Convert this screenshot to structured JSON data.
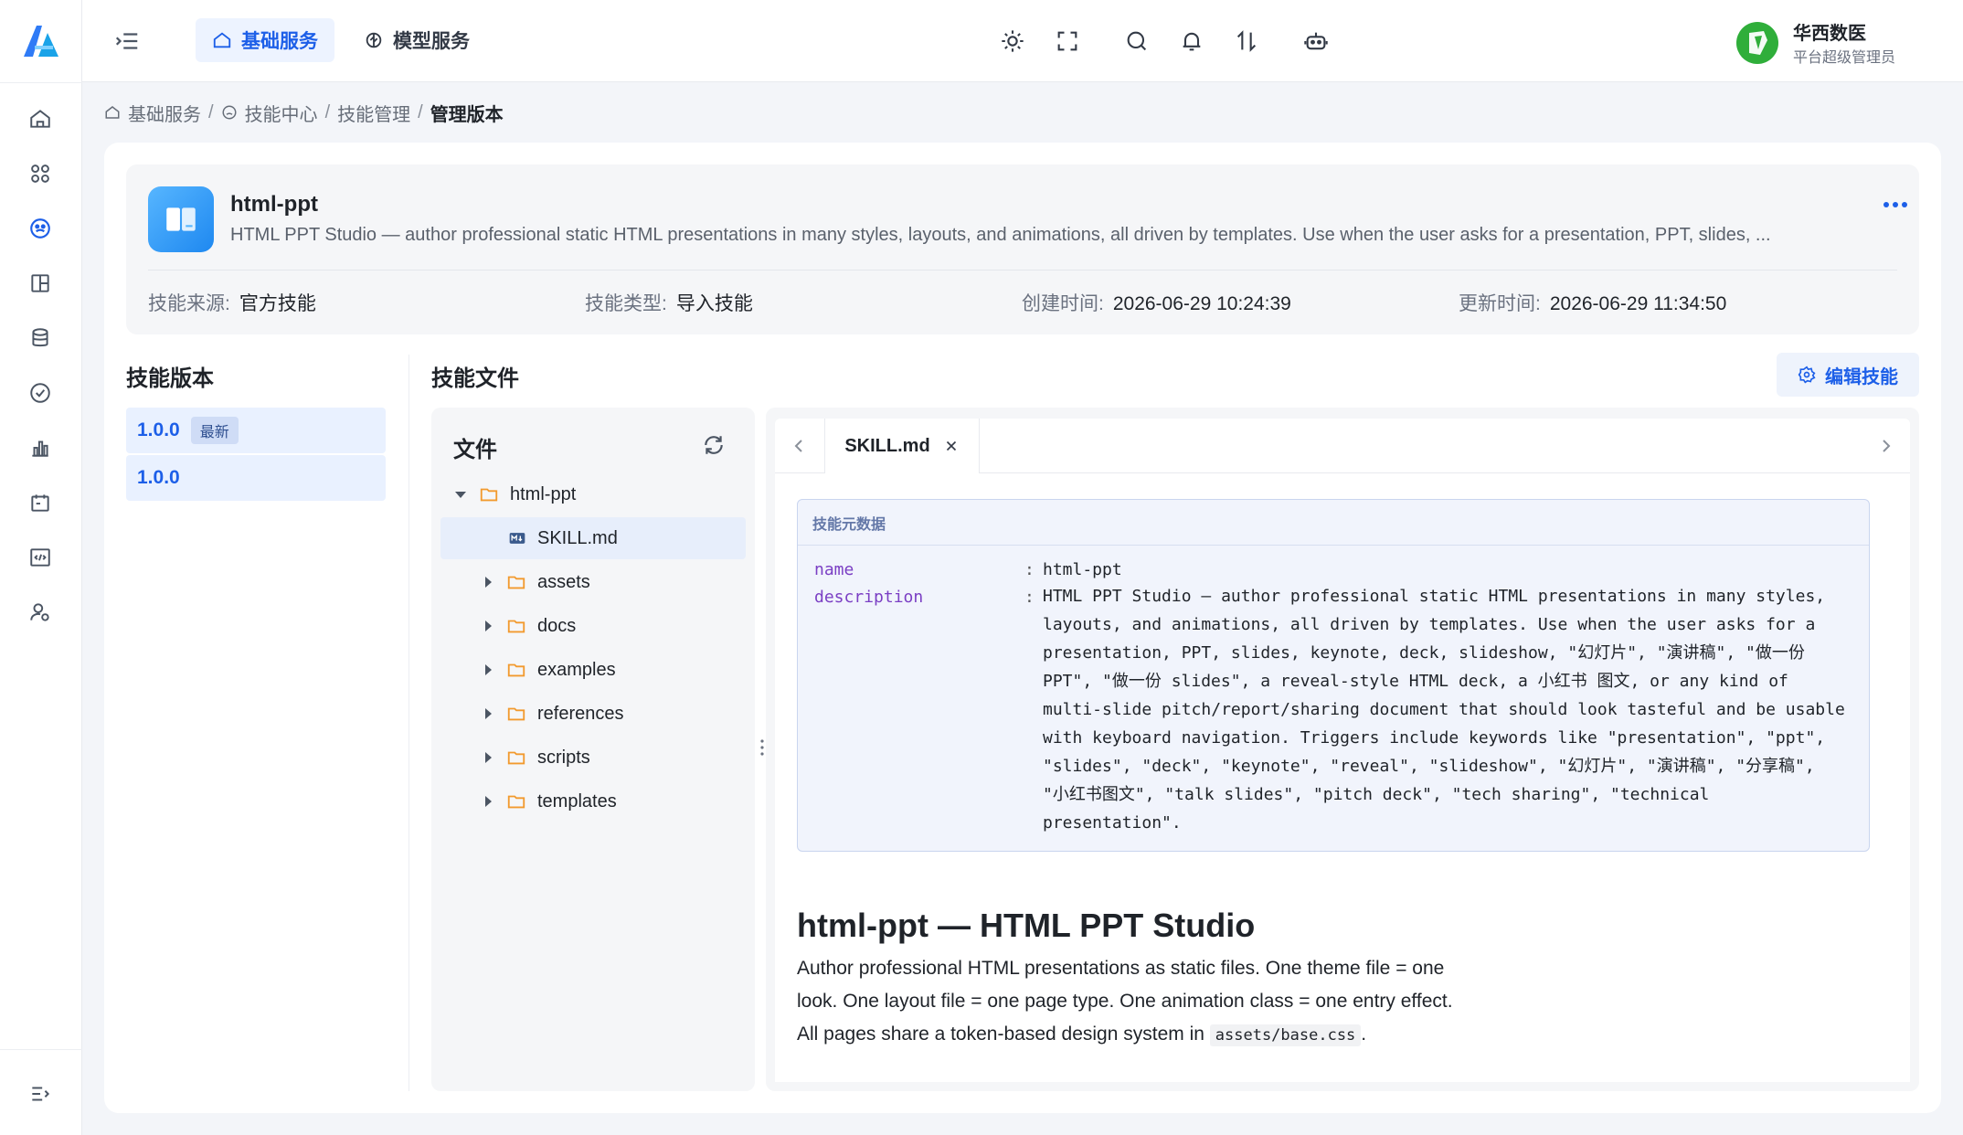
{
  "topbar": {
    "tabs": [
      {
        "label": "基础服务",
        "active": true
      },
      {
        "label": "模型服务",
        "active": false
      }
    ],
    "user": {
      "name": "华西数医",
      "role": "平台超级管理员"
    }
  },
  "breadcrumb": {
    "items": [
      "基础服务",
      "技能中心",
      "技能管理"
    ],
    "current": "管理版本",
    "separator": "/"
  },
  "skill": {
    "name": "html-ppt",
    "description": "HTML PPT Studio — author professional static HTML presentations in many styles, layouts, and animations, all driven by templates. Use when the user asks for a presentation, PPT, slides, ...",
    "meta": [
      {
        "key": "技能来源:",
        "value": "官方技能"
      },
      {
        "key": "技能类型:",
        "value": "导入技能"
      },
      {
        "key": "创建时间:",
        "value": "2026-06-29 10:24:39"
      },
      {
        "key": "更新时间:",
        "value": "2026-06-29 11:34:50"
      }
    ]
  },
  "versions": {
    "title": "技能版本",
    "items": [
      {
        "label": "1.0.0",
        "badge": "最新"
      },
      {
        "label": "1.0.0",
        "badge": ""
      }
    ]
  },
  "files": {
    "title": "技能文件",
    "edit_label": "编辑技能",
    "tree_title": "文件",
    "root": "html-ppt",
    "selected_file": "SKILL.md",
    "folders": [
      "assets",
      "docs",
      "examples",
      "references",
      "scripts",
      "templates"
    ]
  },
  "editor": {
    "tab": "SKILL.md",
    "meta_header": "技能元数据",
    "name_key": "name",
    "name_value": "html-ppt",
    "desc_key": "description",
    "desc_lines": [
      "HTML PPT Studio — author professional static HTML presentations in many styles,",
      "layouts, and animations, all driven by templates. Use when the user asks for a",
      "presentation, PPT, slides, keynote, deck, slideshow, \"幻灯片\", \"演讲稿\", \"做一份",
      "PPT\", \"做一份 slides\", a reveal-style HTML deck, a 小红书 图文, or any kind of",
      "multi-slide pitch/report/sharing document that should look tasteful and be usable",
      "with keyboard navigation. Triggers include keywords like \"presentation\", \"ppt\",",
      "\"slides\", \"deck\", \"keynote\", \"reveal\", \"slideshow\", \"幻灯片\", \"演讲稿\", \"分享稿\",",
      "\"小红书图文\", \"talk slides\", \"pitch deck\", \"tech sharing\", \"technical",
      "presentation\"."
    ],
    "heading": "html-ppt — HTML PPT Studio",
    "para_lines": [
      "Author professional HTML presentations as static files. One theme file = one",
      "look. One layout file = one page type. One animation class = one entry effect.",
      "All pages share a token-based design system in "
    ],
    "code": "assets/base.css",
    "para_end": "."
  },
  "colors": {
    "accent": "#1d5fe8",
    "folder": "#f29a2e"
  }
}
